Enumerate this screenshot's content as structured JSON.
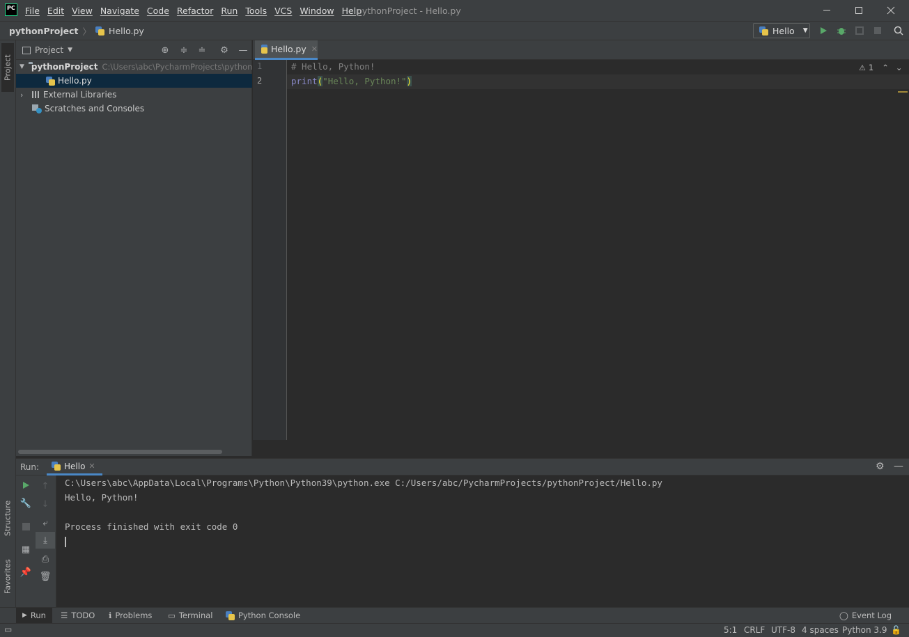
{
  "app": {
    "logo_text": "PC",
    "title": "pythonProject - Hello.py",
    "menu": [
      "File",
      "Edit",
      "View",
      "Navigate",
      "Code",
      "Refactor",
      "Run",
      "Tools",
      "VCS",
      "Window",
      "Help"
    ],
    "window_controls": [
      "minimize",
      "maximize",
      "close"
    ]
  },
  "navbar": {
    "project": "pythonProject",
    "file": "Hello.py",
    "run_config": "Hello"
  },
  "left_strip": {
    "project_tab": "Project",
    "structure_tab": "Structure",
    "favorites_tab": "Favorites"
  },
  "project_panel": {
    "title": "Project",
    "tree": {
      "root_name": "pythonProject",
      "root_path": "C:\\Users\\abc\\PycharmProjects\\pythonProject",
      "file": "Hello.py",
      "external_libraries": "External Libraries",
      "scratches": "Scratches and Consoles"
    }
  },
  "editor": {
    "tab_label": "Hello.py",
    "line_numbers": [
      "1",
      "2"
    ],
    "code": {
      "line1": "# Hello, Python!",
      "fn": "print",
      "open_paren": "(",
      "string": "\"Hello, Python!\"",
      "close_paren": ")"
    },
    "inspection": {
      "warning_count": "1"
    }
  },
  "run_panel": {
    "label": "Run:",
    "tab": "Hello",
    "output": {
      "cmd": "C:\\Users\\abc\\AppData\\Local\\Programs\\Python\\Python39\\python.exe C:/Users/abc/PycharmProjects/pythonProject/Hello.py",
      "stdout": "Hello, Python!",
      "exit": "Process finished with exit code 0"
    }
  },
  "bottom_tabs": {
    "run": "Run",
    "todo": "TODO",
    "problems": "Problems",
    "terminal": "Terminal",
    "python_console": "Python Console",
    "event_log": "Event Log"
  },
  "status": {
    "position": "5:1",
    "line_sep": "CRLF",
    "encoding": "UTF-8",
    "indent": "4 spaces",
    "interpreter": "Python 3.9"
  },
  "colors": {
    "accent": "#4a88c7",
    "selection": "#0d293e",
    "run_green": "#59a869",
    "comment": "#808080",
    "keyword": "#8888c6",
    "string": "#6a8759",
    "paren": "#ffef28"
  }
}
